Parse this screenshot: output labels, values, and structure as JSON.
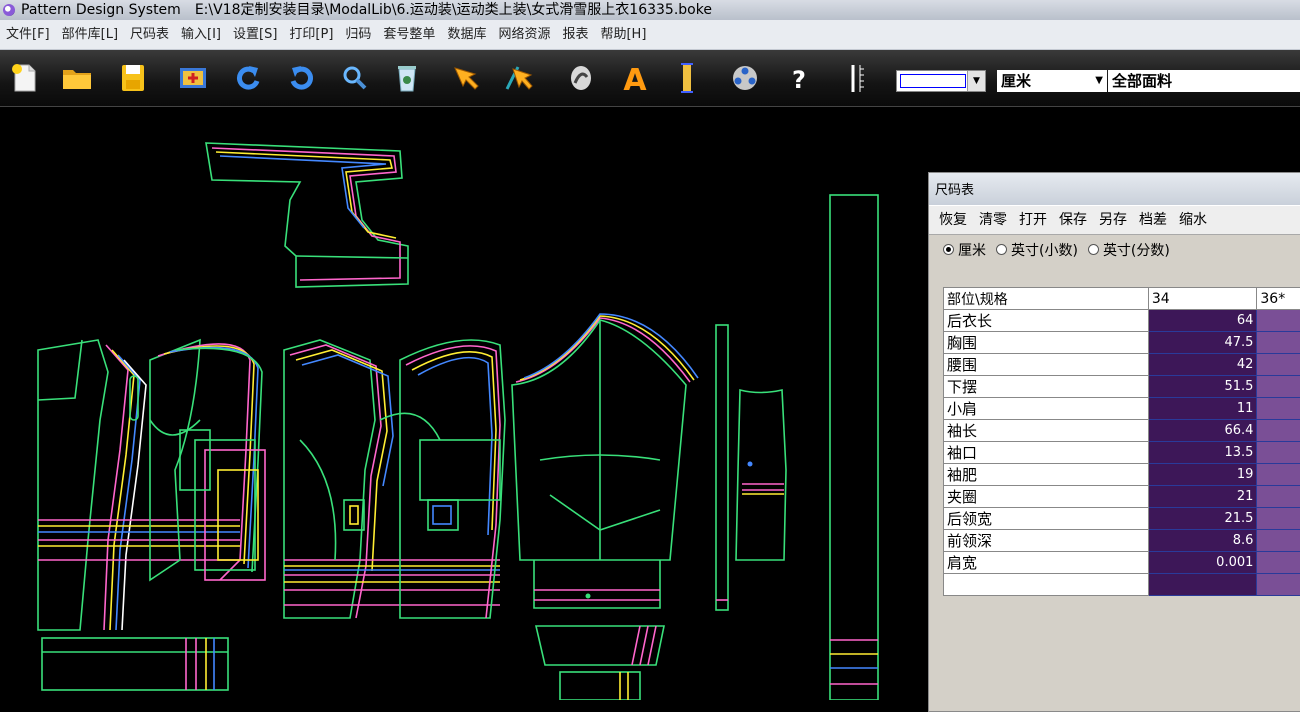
{
  "window": {
    "title": "Pattern Design System",
    "path": "E:\\V18定制安装目录\\ModalLib\\6.运动装\\运动类上装\\女式滑雪服上衣16335.boke"
  },
  "menu": [
    "文件[F]",
    "部件库[L]",
    "尺码表",
    "输入[I]",
    "设置[S]",
    "打印[P]",
    "归码",
    "套号整单",
    "数据库",
    "网络资源",
    "报表",
    "帮助[H]"
  ],
  "toolbar": {
    "buttons": [
      "new-file",
      "open-folder",
      "save",
      "import",
      "undo",
      "redo",
      "zoom",
      "delete",
      "select-arrow",
      "adjust-arrow",
      "mark",
      "text",
      "ruler-vertical",
      "grade",
      "help"
    ],
    "help_label": "?",
    "text_label": "A",
    "unit_label": "厘米",
    "fabric_label": "全部面料"
  },
  "size_panel": {
    "title": "尺码表",
    "menu": [
      "恢复",
      "清零",
      "打开",
      "保存",
      "另存",
      "档差",
      "缩水"
    ],
    "units": [
      "厘米",
      "英寸(小数)",
      "英寸(分数)"
    ],
    "selected_unit": "厘米",
    "table": {
      "header": [
        "部位\\规格",
        "34",
        "36*"
      ],
      "rows": [
        {
          "part": "后衣长",
          "v34": "64"
        },
        {
          "part": "胸围",
          "v34": "47.5"
        },
        {
          "part": "腰围",
          "v34": "42"
        },
        {
          "part": "下摆",
          "v34": "51.5"
        },
        {
          "part": "小肩",
          "v34": "11"
        },
        {
          "part": "袖长",
          "v34": "66.4"
        },
        {
          "part": "袖口",
          "v34": "13.5"
        },
        {
          "part": "袖肥",
          "v34": "19"
        },
        {
          "part": "夹圈",
          "v34": "21"
        },
        {
          "part": "后领宽",
          "v34": "21.5"
        },
        {
          "part": "前领深",
          "v34": "8.6"
        },
        {
          "part": "肩宽",
          "v34": "0.001"
        }
      ]
    }
  },
  "colors": {
    "pattern_main": "#39e07a",
    "grade_pink": "#ff66cc",
    "grade_yellow": "#ffee33",
    "grade_blue": "#4488ff",
    "grade_white": "#ffffff",
    "cell_dark": "#3d1758",
    "cell_light": "#7a4f96"
  }
}
